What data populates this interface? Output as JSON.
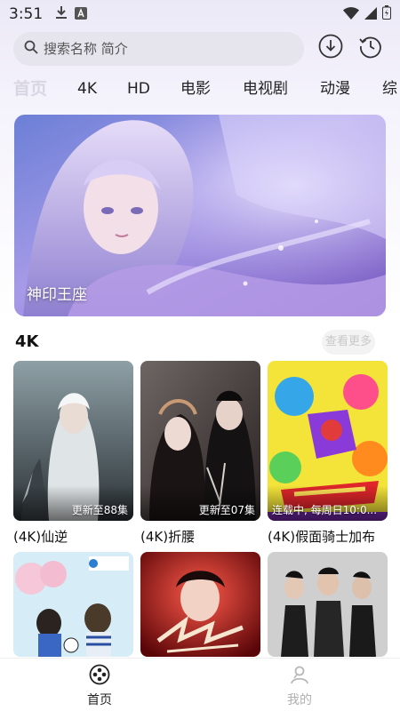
{
  "status_bar": {
    "time": "3:51",
    "icons": [
      "download-icon",
      "a-badge-icon",
      "wifi-icon",
      "signal-icon",
      "battery-icon"
    ]
  },
  "search": {
    "placeholder": "搜索名称 简介"
  },
  "header_actions": [
    "download-circle-icon",
    "history-clock-icon"
  ],
  "tabs": [
    {
      "label": "首页",
      "active": true
    },
    {
      "label": "4K",
      "active": false
    },
    {
      "label": "HD",
      "active": false
    },
    {
      "label": "电影",
      "active": false
    },
    {
      "label": "电视剧",
      "active": false
    },
    {
      "label": "动漫",
      "active": false
    },
    {
      "label": "综",
      "active": false
    }
  ],
  "banner": {
    "caption": "神印王座"
  },
  "section": {
    "title": "4K",
    "see_more": "查看更多"
  },
  "cards": [
    {
      "title": "(4K)仙逆",
      "badge": "更新至88集"
    },
    {
      "title": "(4K)折腰",
      "badge": "更新至07集"
    },
    {
      "title": "(4K)假面骑士加布",
      "badge": "连载中, 每周日10:0..."
    },
    {
      "title": "",
      "badge": ""
    },
    {
      "title": "",
      "badge": ""
    },
    {
      "title": "",
      "badge": ""
    }
  ],
  "bottom_nav": [
    {
      "label": "首页",
      "active": true
    },
    {
      "label": "我的",
      "active": false
    }
  ],
  "colors": {
    "accent": "#222222",
    "tab_active": "#d9d6e3",
    "search_bg": "#e6e4ec"
  }
}
